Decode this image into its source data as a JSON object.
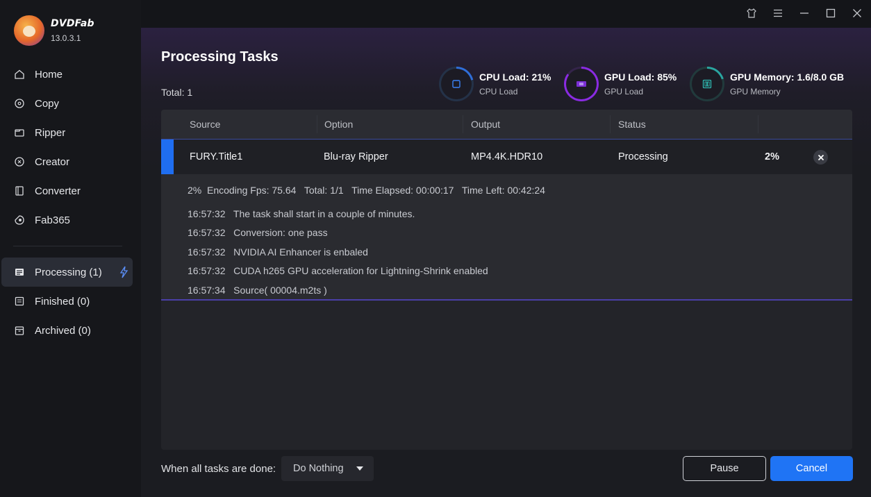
{
  "app": {
    "name": "DVDFab",
    "version": "13.0.3.1"
  },
  "sidebar": {
    "items": [
      {
        "label": "Home",
        "icon": "home-icon"
      },
      {
        "label": "Copy",
        "icon": "copy-icon"
      },
      {
        "label": "Ripper",
        "icon": "ripper-icon"
      },
      {
        "label": "Creator",
        "icon": "creator-icon"
      },
      {
        "label": "Converter",
        "icon": "converter-icon"
      },
      {
        "label": "Fab365",
        "icon": "fab365-icon"
      }
    ],
    "tasks": [
      {
        "label": "Processing (1)",
        "icon": "processing-icon",
        "active": true
      },
      {
        "label": "Finished (0)",
        "icon": "finished-icon"
      },
      {
        "label": "Archived (0)",
        "icon": "archived-icon"
      }
    ]
  },
  "window": {
    "buttons": [
      "skin-icon",
      "menu-icon",
      "minimize-icon",
      "maximize-icon",
      "close-icon"
    ]
  },
  "main": {
    "title": "Processing Tasks",
    "total": "Total: 1",
    "stats": [
      {
        "title": "CPU Load: 21%",
        "sub": "CPU Load",
        "color": "#2f6ed8"
      },
      {
        "title": "GPU Load: 85%",
        "sub": "GPU Load",
        "color": "#8a2be2"
      },
      {
        "title": "GPU Memory: 1.6/8.0 GB",
        "sub": "GPU Memory",
        "color": "#2aa5a0"
      }
    ],
    "table": {
      "headers": [
        "Source",
        "Option",
        "Output",
        "Status"
      ],
      "row": {
        "source": "FURY.Title1",
        "option": "Blu-ray Ripper",
        "output": "MP4.4K.HDR10",
        "status": "Processing",
        "percent": "2%"
      },
      "summary": "2%  Encoding Fps: 75.64   Total: 1/1   Time Elapsed: 00:00:17   Time Left: 00:42:24",
      "log": [
        "16:57:32   The task shall start in a couple of minutes.",
        "16:57:32   Conversion: one pass",
        "16:57:32   NVIDIA AI Enhancer is enbaled",
        "16:57:32   CUDA h265 GPU acceleration for Lightning-Shrink enabled",
        "16:57:34   Source( 00004.m2ts )"
      ]
    },
    "footer": {
      "label": "When all tasks are done:",
      "select_value": "Do Nothing",
      "pause": "Pause",
      "cancel": "Cancel"
    }
  },
  "colors": {
    "accent": "#1f74f5",
    "row_accent": "#1f6ef0"
  }
}
